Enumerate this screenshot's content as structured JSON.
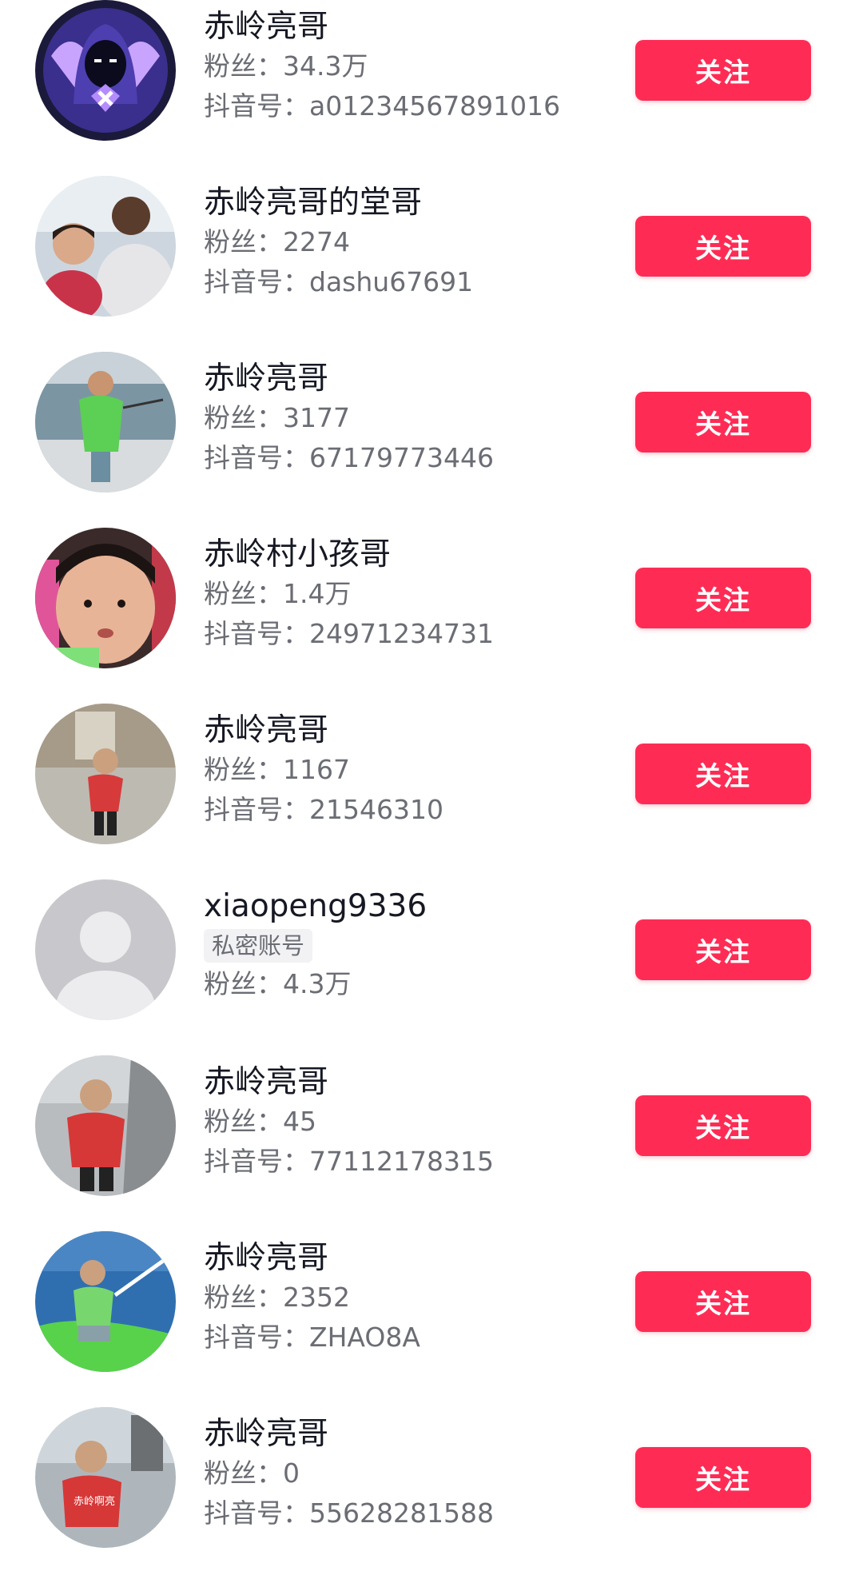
{
  "labels": {
    "fans": "粉丝：",
    "douyin_id": "抖音号：",
    "follow": "关注"
  },
  "colors": {
    "follow_button": "#fe2c55",
    "name_text": "#161823",
    "meta_text": "#6b6d74"
  },
  "users": [
    {
      "name": "赤岭亮哥",
      "fans": "34.3万",
      "douyin_id": "a01234567891016",
      "avatar": "hooded-figure-badge-avatar"
    },
    {
      "name": "赤岭亮哥的堂哥",
      "fans": "2274",
      "douyin_id": "dashu67691",
      "avatar": "photo-avatar"
    },
    {
      "name": "赤岭亮哥",
      "fans": "3177",
      "douyin_id": "67179773446",
      "avatar": "photo-avatar"
    },
    {
      "name": "赤岭村小孩哥",
      "fans": "1.4万",
      "douyin_id": "24971234731",
      "avatar": "photo-avatar"
    },
    {
      "name": "赤岭亮哥",
      "fans": "1167",
      "douyin_id": "21546310",
      "avatar": "photo-avatar"
    },
    {
      "name": "xiaopeng9336",
      "private_badge": "私密账号",
      "fans": "4.3万",
      "avatar": "default-user-avatar"
    },
    {
      "name": "赤岭亮哥",
      "fans": "45",
      "douyin_id": "77112178315",
      "avatar": "photo-avatar"
    },
    {
      "name": "赤岭亮哥",
      "fans": "2352",
      "douyin_id": "ZHAO8A",
      "avatar": "photo-avatar"
    },
    {
      "name": "赤岭亮哥",
      "fans": "0",
      "douyin_id": "55628281588",
      "avatar": "photo-avatar",
      "avatar_caption": "赤岭啊亮"
    }
  ]
}
